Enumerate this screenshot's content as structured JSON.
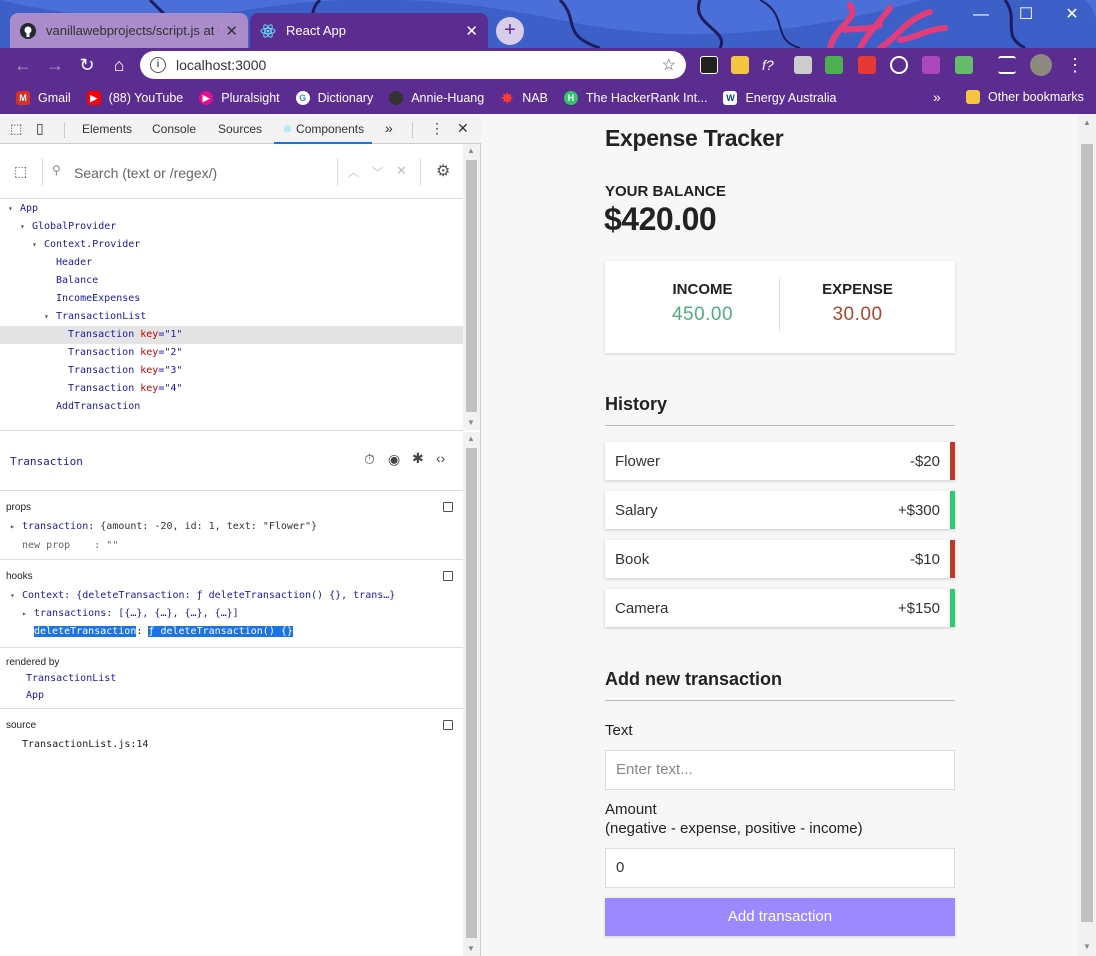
{
  "browser": {
    "tabs": [
      {
        "title": "vanillawebprojects/script.js at ma",
        "icon": "github-icon"
      },
      {
        "title": "React App",
        "icon": "react-icon"
      }
    ],
    "url": "localhost:3000",
    "bookmarks": [
      {
        "label": "Gmail",
        "icon": "gmail-icon",
        "color": "#d93025"
      },
      {
        "label": "(88) YouTube",
        "icon": "youtube-icon",
        "color": "#ff0000"
      },
      {
        "label": "Pluralsight",
        "icon": "pluralsight-icon",
        "color": "#e80a89"
      },
      {
        "label": "Dictionary",
        "icon": "google-icon",
        "color": "#4285f4"
      },
      {
        "label": "Annie-Huang",
        "icon": "github-icon",
        "color": "#333333"
      },
      {
        "label": "NAB",
        "icon": "nab-star-icon",
        "color": "#c8102e"
      },
      {
        "label": "The HackerRank Int...",
        "icon": "hackerrank-icon",
        "color": "#2ec866"
      },
      {
        "label": "Energy Australia",
        "icon": "energy-australia-icon",
        "color": "#004b87"
      }
    ],
    "overflow_label": "»",
    "other_bookmarks": "Other bookmarks"
  },
  "devtools": {
    "tabs": [
      "Elements",
      "Console",
      "Sources",
      "Components",
      "»"
    ],
    "active_tab": "Components",
    "search_placeholder": "Search (text or /regex/)",
    "tree": [
      {
        "name": "App",
        "indent": 0,
        "toggle": "▾"
      },
      {
        "name": "GlobalProvider",
        "indent": 1,
        "toggle": "▾"
      },
      {
        "name": "Context.Provider",
        "indent": 2,
        "toggle": "▾"
      },
      {
        "name": "Header",
        "indent": 3,
        "toggle": ""
      },
      {
        "name": "Balance",
        "indent": 3,
        "toggle": ""
      },
      {
        "name": "IncomeExpenses",
        "indent": 3,
        "toggle": ""
      },
      {
        "name": "TransactionList",
        "indent": 3,
        "toggle": "▾"
      },
      {
        "name": "Transaction",
        "key": "key",
        "keyval": "\"1\"",
        "indent": 4,
        "toggle": "",
        "selected": true
      },
      {
        "name": "Transaction",
        "key": "key",
        "keyval": "\"2\"",
        "indent": 4,
        "toggle": ""
      },
      {
        "name": "Transaction",
        "key": "key",
        "keyval": "\"3\"",
        "indent": 4,
        "toggle": ""
      },
      {
        "name": "Transaction",
        "key": "key",
        "keyval": "\"4\"",
        "indent": 4,
        "toggle": ""
      },
      {
        "name": "AddTransaction",
        "indent": 3,
        "toggle": ""
      }
    ],
    "selected_component": "Transaction",
    "props": {
      "title": "props",
      "transaction_key": "transaction",
      "transaction_value": "{amount: -20, id: 1, text: \"Flower\"}",
      "new_prop_key": "new prop",
      "new_prop_value": ": \"\""
    },
    "hooks": {
      "title": "hooks",
      "context_key": "Context",
      "context_value": "{deleteTransaction: ƒ deleteTransaction() {}, trans…}",
      "transactions_key": "transactions",
      "transactions_value": "[{…}, {…}, {…}, {…}]",
      "delete_key": "deleteTransaction",
      "delete_value": "ƒ deleteTransaction() {}"
    },
    "rendered_by": {
      "title": "rendered by",
      "items": [
        "TransactionList",
        "App"
      ]
    },
    "source": {
      "title": "source",
      "file": "TransactionList.js:14"
    }
  },
  "app": {
    "title": "Expense Tracker",
    "balance_label": "YOUR BALANCE",
    "balance_value": "$420.00",
    "income_label": "INCOME",
    "income_value": "450.00",
    "expense_label": "EXPENSE",
    "expense_value": "30.00",
    "history_title": "History",
    "transactions": [
      {
        "text": "Flower",
        "amount": "-$20",
        "type": "minus"
      },
      {
        "text": "Salary",
        "amount": "+$300",
        "type": "plus"
      },
      {
        "text": "Book",
        "amount": "-$10",
        "type": "minus"
      },
      {
        "text": "Camera",
        "amount": "+$150",
        "type": "plus"
      }
    ],
    "add_title": "Add new transaction",
    "text_label": "Text",
    "text_placeholder": "Enter text...",
    "amount_label": "Amount",
    "amount_hint": "(negative - expense, positive - income)",
    "amount_value": "0",
    "submit_label": "Add transaction",
    "colors": {
      "plus": "#2ecc71",
      "minus": "#c0392b",
      "income": "#4caf7d",
      "expense": "#b0452f",
      "button": "#9c88ff"
    }
  }
}
